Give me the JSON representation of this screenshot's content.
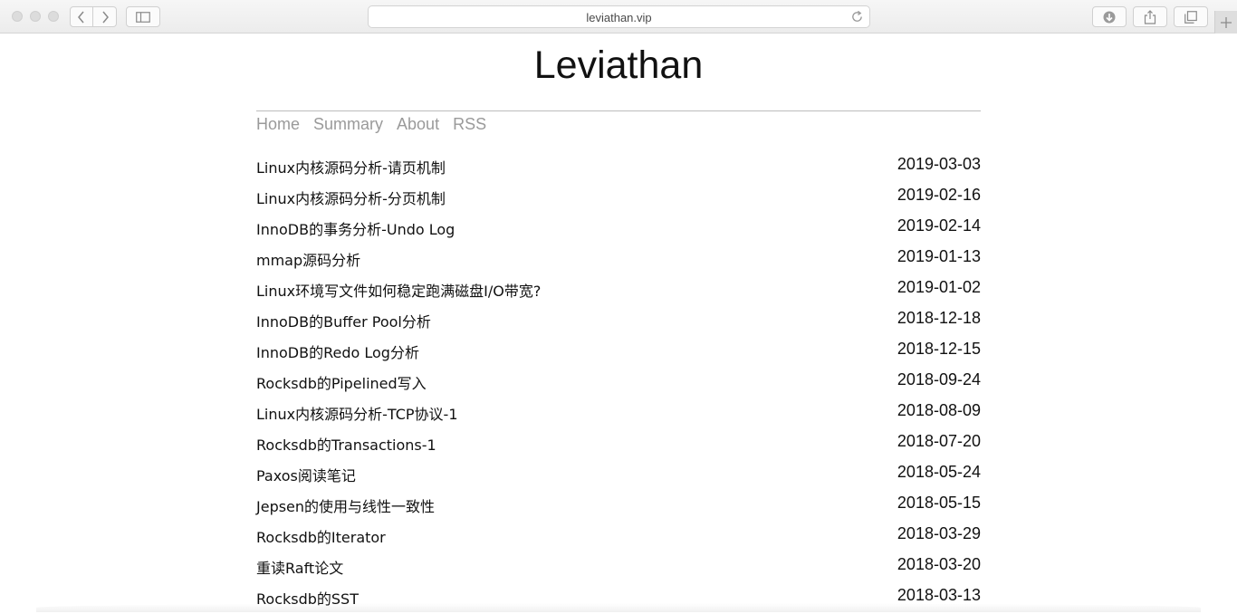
{
  "browser": {
    "url": "leviathan.vip",
    "icons": {
      "back": "chevron-left-icon",
      "forward": "chevron-right-icon",
      "sidebar": "sidebar-icon",
      "reload": "reload-icon",
      "downloads": "download-icon",
      "share": "share-icon",
      "tabs": "tabs-icon",
      "new_tab": "plus-icon"
    }
  },
  "site": {
    "title": "Leviathan",
    "nav": [
      "Home",
      "Summary",
      "About",
      "RSS"
    ]
  },
  "posts": [
    {
      "title": "Linux内核源码分析-请页机制",
      "date": "2019-03-03"
    },
    {
      "title": "Linux内核源码分析-分页机制",
      "date": "2019-02-16"
    },
    {
      "title": "InnoDB的事务分析-Undo Log",
      "date": "2019-02-14"
    },
    {
      "title": "mmap源码分析",
      "date": "2019-01-13"
    },
    {
      "title": "Linux环境写文件如何稳定跑满磁盘I/O带宽?",
      "date": "2019-01-02"
    },
    {
      "title": "InnoDB的Buffer Pool分析",
      "date": "2018-12-18"
    },
    {
      "title": "InnoDB的Redo Log分析",
      "date": "2018-12-15"
    },
    {
      "title": "Rocksdb的Pipelined写入",
      "date": "2018-09-24"
    },
    {
      "title": "Linux内核源码分析-TCP协议-1",
      "date": "2018-08-09"
    },
    {
      "title": "Rocksdb的Transactions-1",
      "date": "2018-07-20"
    },
    {
      "title": "Paxos阅读笔记",
      "date": "2018-05-24"
    },
    {
      "title": "Jepsen的使用与线性一致性",
      "date": "2018-05-15"
    },
    {
      "title": "Rocksdb的Iterator",
      "date": "2018-03-29"
    },
    {
      "title": "重读Raft论文",
      "date": "2018-03-20"
    },
    {
      "title": "Rocksdb的SST",
      "date": "2018-03-13"
    }
  ]
}
